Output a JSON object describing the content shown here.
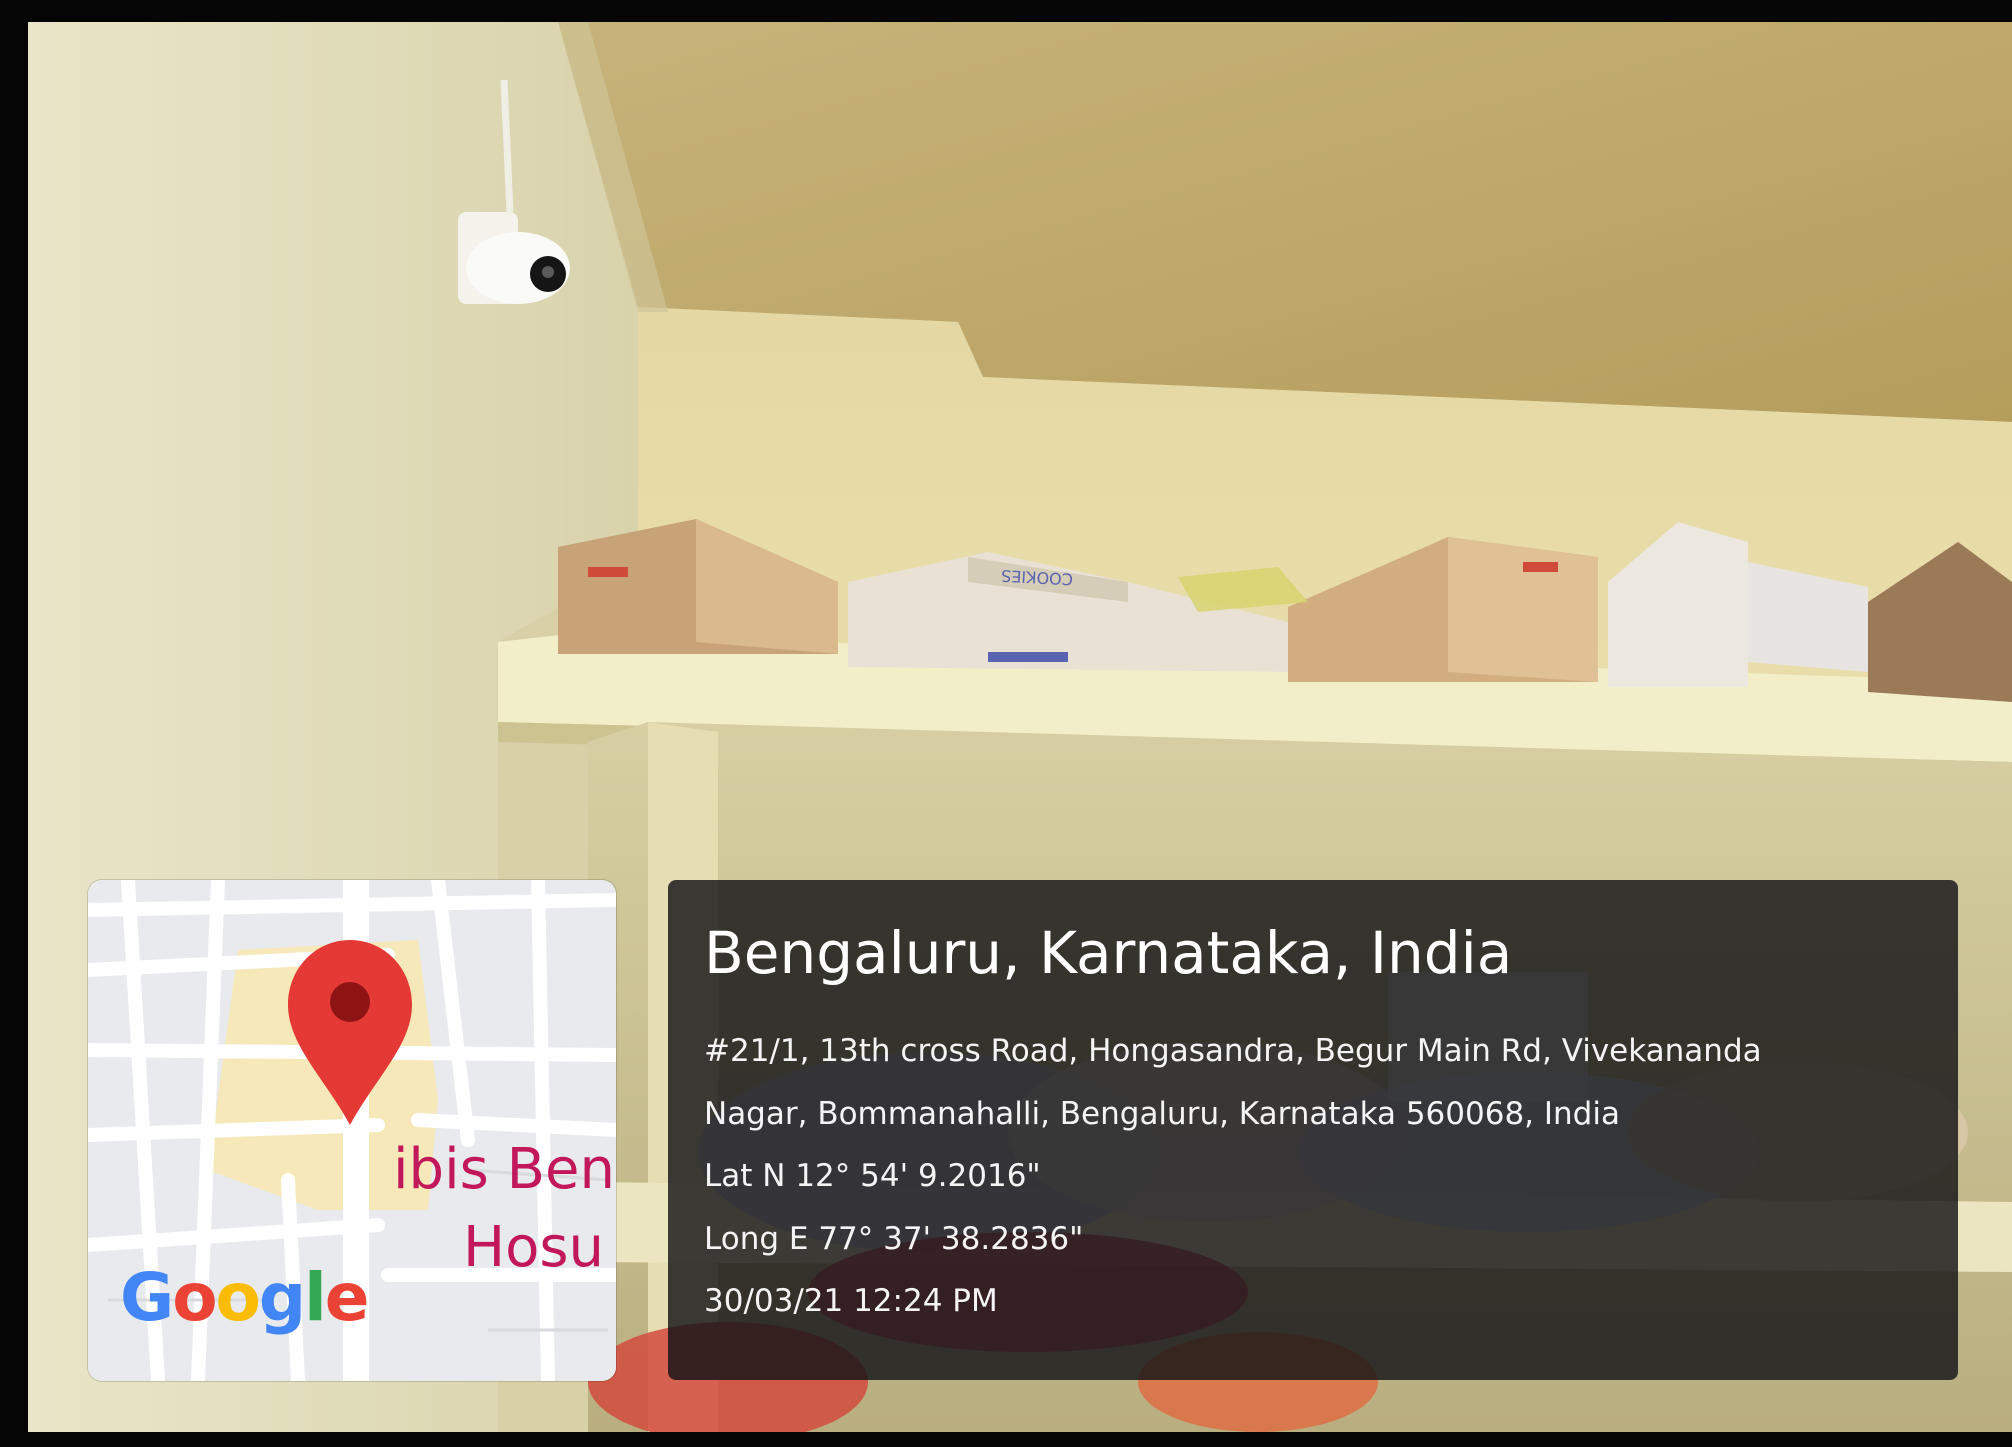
{
  "location": {
    "city_line": "Bengaluru, Karnataka, India",
    "address_line_1": "#21/1, 13th cross Road, Hongasandra, Begur Main Rd, Vivekananda",
    "address_line_2": "Nagar, Bommanahalli, Bengaluru, Karnataka 560068, India",
    "latitude": "Lat N 12° 54' 9.2016\"",
    "longitude": "Long E 77° 37' 38.2836\"",
    "timestamp": "30/03/21 12:24 PM"
  },
  "map": {
    "place_label_1": "ibis Ben",
    "place_label_2": "Hosu",
    "pin_color": "#e53935",
    "logo_letters": [
      {
        "ch": "G",
        "color": "#4285F4"
      },
      {
        "ch": "o",
        "color": "#EA4335"
      },
      {
        "ch": "o",
        "color": "#FBBC05"
      },
      {
        "ch": "g",
        "color": "#4285F4"
      },
      {
        "ch": "l",
        "color": "#34A853"
      },
      {
        "ch": "e",
        "color": "#EA4335"
      }
    ]
  },
  "photo": {
    "box_print": "COOKIES",
    "icons": [
      "cctv-camera-icon",
      "map-pin-icon"
    ]
  }
}
